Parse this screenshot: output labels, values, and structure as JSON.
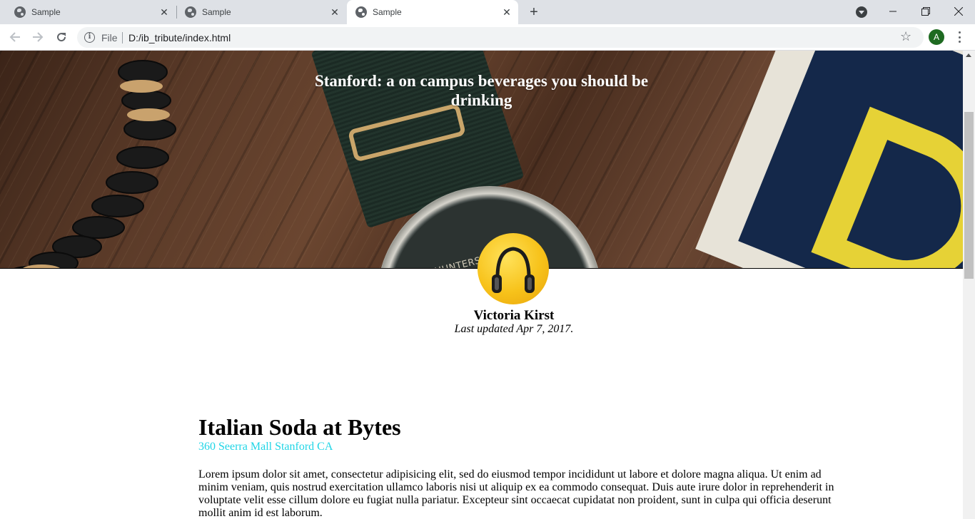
{
  "browser": {
    "tabs": [
      {
        "title": "Sample",
        "active": false
      },
      {
        "title": "Sample",
        "active": false
      },
      {
        "title": "Sample",
        "active": true
      }
    ],
    "address": {
      "scheme_label": "File",
      "url": "D:/ib_tribute/index.html"
    },
    "profile_initial": "A",
    "profile_color": "#1e6a21"
  },
  "page": {
    "hero_title": "Stanford: a on campus beverages you should be drinking",
    "author_name": "Victoria Kirst",
    "last_updated": "Last updated Apr 7, 2017.",
    "article": {
      "heading": "Italian Soda at Bytes",
      "address": "360 Seerra Mall Stanford CA",
      "address_color": "#1fd5e6",
      "body": "Lorem ipsum dolor sit amet, consectetur adipisicing elit, sed do eiusmod tempor incididunt ut labore et dolore magna aliqua. Ut enim ad minim veniam, quis nostrud exercitation ullamco laboris nisi ut aliquip ex ea commodo consequat. Duis aute irure dolor in reprehenderit in voluptate velit esse cillum dolore eu fugiat nulla pariatur. Excepteur sint occaecat cupidatat non proident, sunt in culpa qui officia deserunt mollit anim id est laborum."
    },
    "hero_watch_text": "HUNTERS RACE"
  }
}
